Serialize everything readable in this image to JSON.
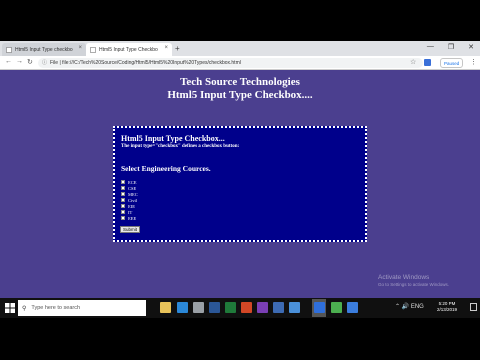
{
  "browser": {
    "tabs": [
      {
        "label": "Html5 Input Type checkbo",
        "active": false
      },
      {
        "label": "Html5 Input Type Checkbo",
        "active": true
      }
    ],
    "new_tab_label": "+",
    "window_controls": {
      "minimize": "—",
      "maximize": "❐",
      "close": "✕"
    },
    "address": "File  |  file:///C:/Tech%20Source/Coding/Html5/Html5%20Input%20Types/checkbox.html",
    "paused_label": "Paused"
  },
  "page": {
    "heading_1": "Tech Source Technologies",
    "heading_2": "Html5 Input Type Checkbox....",
    "form": {
      "title": "Html5 Input Type Checkbox...",
      "description": "The input type=\"checkbox\" defines a checkbox button:",
      "select_heading": "Select Engineering Cources.",
      "options": [
        {
          "label": "ECE",
          "checked": false
        },
        {
          "label": "CSE",
          "checked": false
        },
        {
          "label": "MEC",
          "checked": false
        },
        {
          "label": "Civil",
          "checked": false
        },
        {
          "label": "EIE",
          "checked": false
        },
        {
          "label": "IT",
          "checked": false
        },
        {
          "label": "EEE",
          "checked": false
        }
      ],
      "submit_label": "Submit"
    }
  },
  "watermark": {
    "line1": "Activate Windows",
    "line2": "Go to Settings to activate Windows."
  },
  "taskbar": {
    "search_placeholder": "Type here to search",
    "tray_text": "⌃  🔊  ENG",
    "time": "5:20 PM",
    "date": "2/13/2019"
  },
  "colors": {
    "page_background": "#4b3f8f",
    "form_background": "#00008b",
    "taskbar": "#101010"
  }
}
